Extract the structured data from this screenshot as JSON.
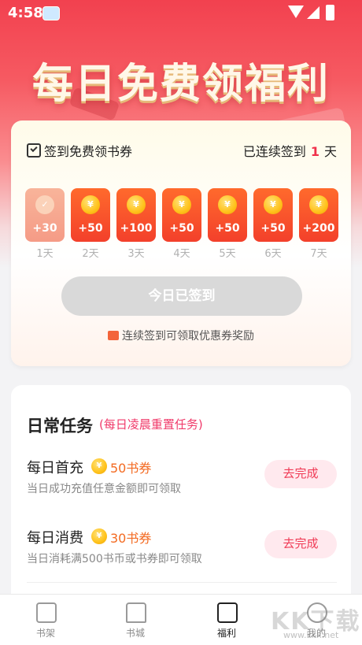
{
  "status_bar": {
    "time": "4:58"
  },
  "banner": {
    "title": "每日免费领福利"
  },
  "sign_in": {
    "title": "签到免费领书券",
    "streak_prefix": "已连续签到",
    "streak_count": "1",
    "streak_suffix": "天",
    "days": [
      {
        "amount": "+30",
        "label": "1天",
        "signed": true
      },
      {
        "amount": "+50",
        "label": "2天",
        "signed": false
      },
      {
        "amount": "+100",
        "label": "3天",
        "signed": false
      },
      {
        "amount": "+50",
        "label": "4天",
        "signed": false
      },
      {
        "amount": "+50",
        "label": "5天",
        "signed": false
      },
      {
        "amount": "+50",
        "label": "6天",
        "signed": false
      },
      {
        "amount": "+200",
        "label": "7天",
        "signed": false
      }
    ],
    "coin_symbol": "¥",
    "button_label": "今日已签到",
    "hint": "连续签到可领取优惠券奖励"
  },
  "tasks": {
    "title": "日常任务",
    "subtitle": "(每日凌晨重置任务)",
    "items": [
      {
        "name": "每日首充",
        "reward": "50书券",
        "desc": "当日成功充值任意金额即可领取",
        "button": "去完成"
      },
      {
        "name": "每日消费",
        "reward": "30书券",
        "desc": "当日消耗满500书币或书券即可领取",
        "button": "去完成"
      }
    ]
  },
  "nav": {
    "items": [
      {
        "label": "书架",
        "icon": "bookshelf-icon"
      },
      {
        "label": "书城",
        "icon": "bookstore-icon"
      },
      {
        "label": "福利",
        "icon": "gift-icon",
        "active": true
      },
      {
        "label": "我的",
        "icon": "profile-icon"
      }
    ]
  },
  "watermark": {
    "text": "KK下载",
    "url": "www.kkx.net"
  },
  "colors": {
    "accent": "#f0304a",
    "orange": "#f3402b",
    "coin": "#ffc21a"
  }
}
